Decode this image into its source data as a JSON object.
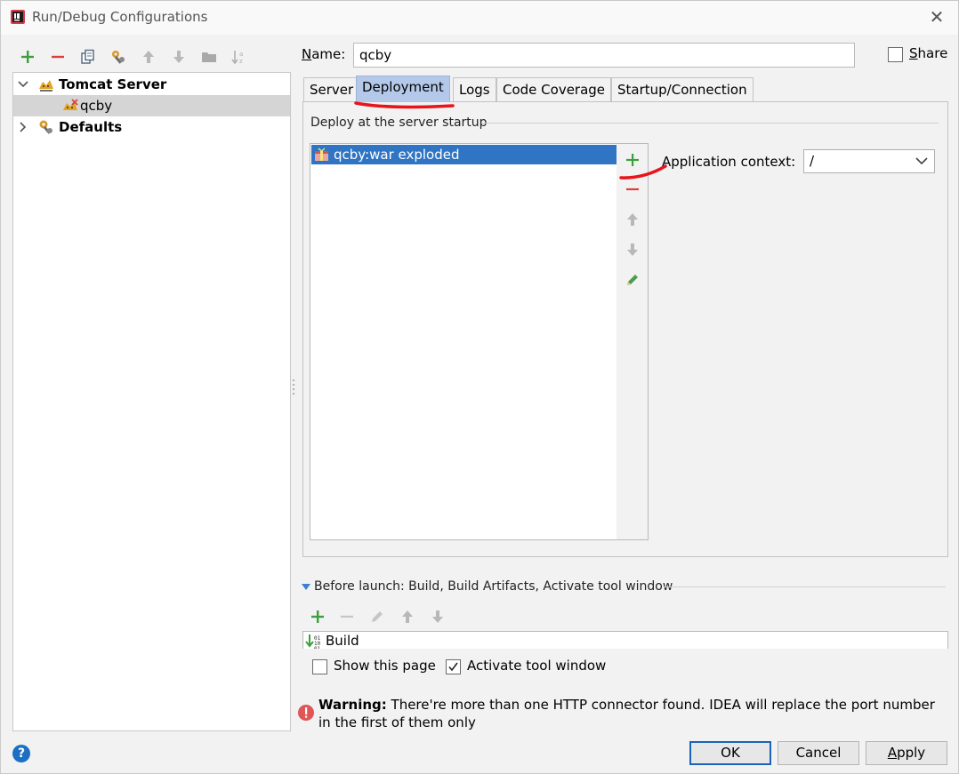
{
  "window": {
    "title": "Run/Debug Configurations"
  },
  "tree": {
    "items": [
      {
        "label": "Tomcat Server",
        "expanded": true,
        "bold": true,
        "icon": "tomcat-icon"
      },
      {
        "label": "qcby",
        "selected": true,
        "icon": "tomcat-config-icon"
      },
      {
        "label": "Defaults",
        "expanded": false,
        "bold": true,
        "icon": "wrench-icon"
      }
    ]
  },
  "form": {
    "name_label": "Name:",
    "name_value": "qcby",
    "share_label": "Share",
    "share_checked": false
  },
  "tabs": [
    {
      "label": "Server"
    },
    {
      "label": "Deployment",
      "active": true
    },
    {
      "label": "Logs"
    },
    {
      "label": "Code Coverage"
    },
    {
      "label": "Startup/Connection"
    }
  ],
  "deployment": {
    "section_title": "Deploy at the server startup",
    "artifacts": [
      "qcby:war exploded"
    ],
    "context_label": "Application context:",
    "context_value": "/"
  },
  "before_launch": {
    "title": "Before launch: Build, Build Artifacts, Activate tool window",
    "tasks": [
      "Build"
    ],
    "show_page_label": "Show this page",
    "show_page_checked": false,
    "activate_label": "Activate tool window",
    "activate_checked": true
  },
  "warning": {
    "prefix": "Warning:",
    "text": " There're more than one HTTP connector found. IDEA will replace the port number in the first of them only"
  },
  "buttons": {
    "ok": "OK",
    "cancel": "Cancel",
    "apply": "Apply",
    "help": "?"
  },
  "colors": {
    "selection": "#2f75c4",
    "active_tab": "#b4c9e9",
    "add_green": "#3c9e3c",
    "remove_red": "#d9423a",
    "annotation_red": "#e8141c"
  }
}
